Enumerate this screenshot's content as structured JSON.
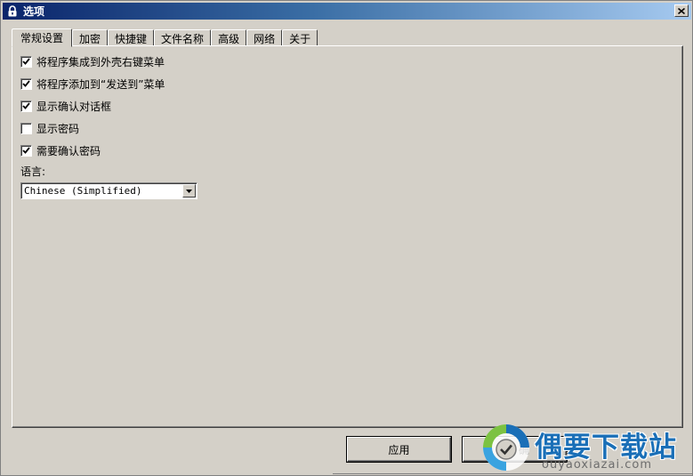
{
  "window": {
    "title": "选项"
  },
  "tabs": [
    {
      "label": "常规设置",
      "active": true
    },
    {
      "label": "加密",
      "active": false
    },
    {
      "label": "快捷键",
      "active": false
    },
    {
      "label": "文件名称",
      "active": false
    },
    {
      "label": "高级",
      "active": false
    },
    {
      "label": "网络",
      "active": false
    },
    {
      "label": "关于",
      "active": false
    }
  ],
  "options": [
    {
      "label": "将程序集成到外壳右键菜单",
      "checked": true
    },
    {
      "label": "将程序添加到“发送到”菜单",
      "checked": true
    },
    {
      "label": "显示确认对话框",
      "checked": true
    },
    {
      "label": "显示密码",
      "checked": false
    },
    {
      "label": "需要确认密码",
      "checked": true
    }
  ],
  "language": {
    "label": "语言:",
    "value": "Chinese (Simplified)"
  },
  "buttons": {
    "apply": "应用",
    "ok": "确"
  },
  "watermark": {
    "brand": "偶要下载站",
    "url": "ouyaoxiazai.com",
    "color": "#1a6fb7"
  },
  "icons": {
    "title": "lock-icon",
    "close": "close-icon",
    "dropdown": "chevron-down-icon",
    "check": "checkmark-icon"
  }
}
